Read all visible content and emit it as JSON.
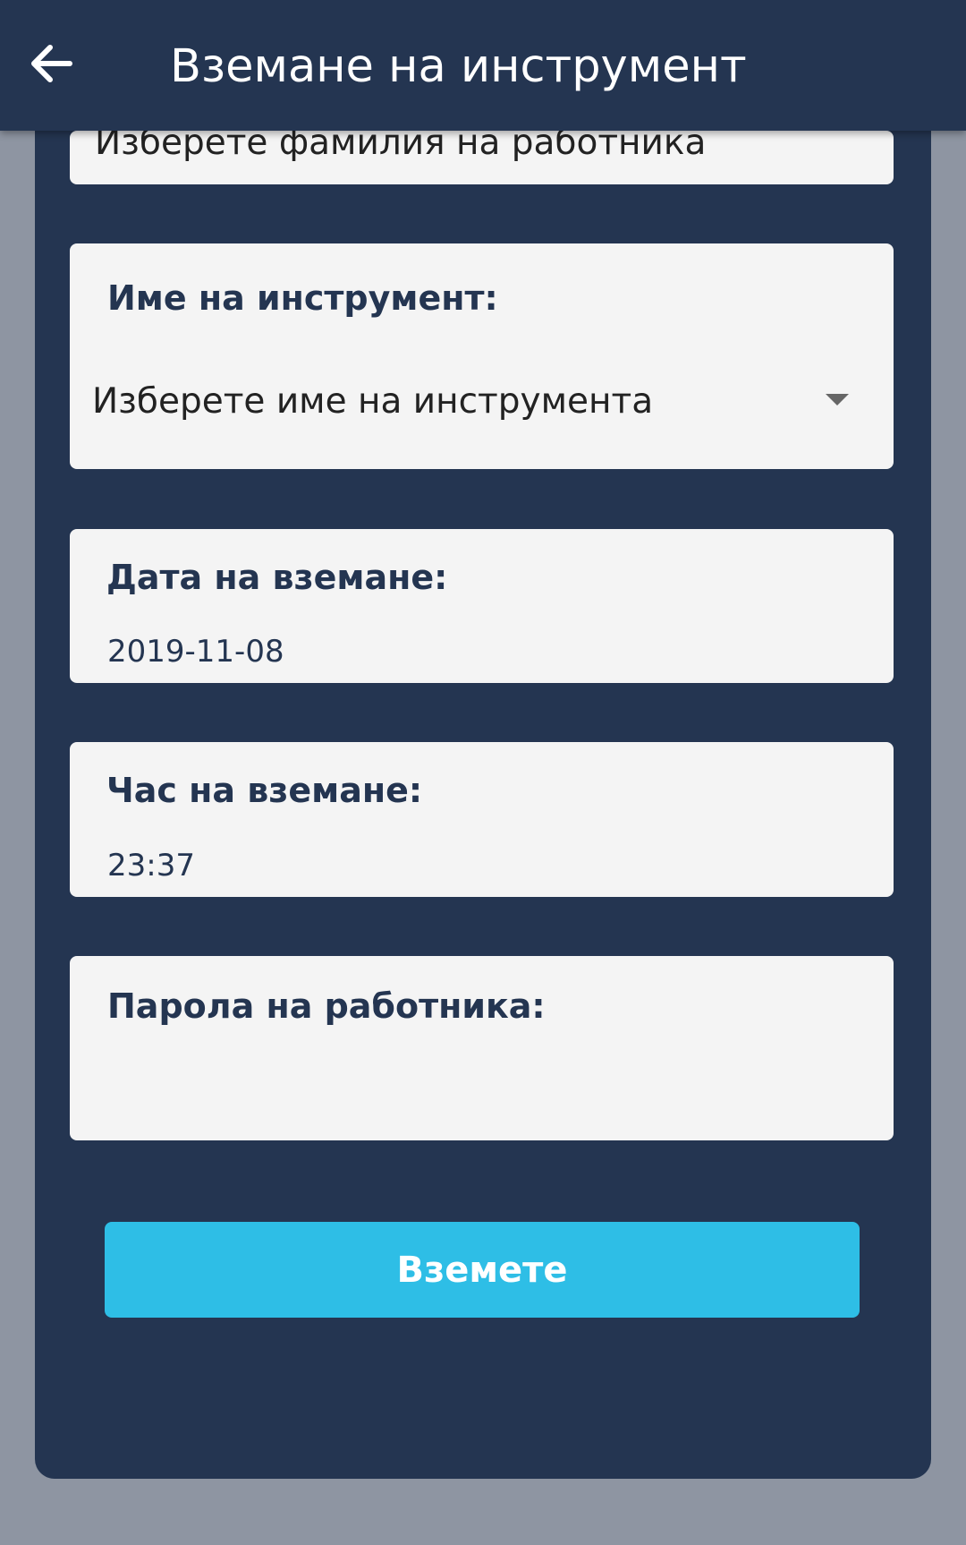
{
  "app_bar": {
    "title": "Вземане на инструмент",
    "back_icon": "arrow-left-icon"
  },
  "form": {
    "worker_surname": {
      "placeholder": "Изберете фамилия на работника"
    },
    "tool_name": {
      "label": "Име на инструмент:",
      "placeholder": "Изберете име на инструмента",
      "dropdown_icon": "caret-down-icon"
    },
    "date": {
      "label": "Дата на вземане:",
      "value": "2019-11-08"
    },
    "time": {
      "label": "Час на вземане:",
      "value": "23:37"
    },
    "password": {
      "label": "Парола на работника:",
      "value": ""
    },
    "submit_label": "Вземете"
  },
  "colors": {
    "primary": "#243551",
    "accent": "#2ebee6",
    "card": "#f4f4f4",
    "backdrop": "#8e95a2"
  }
}
